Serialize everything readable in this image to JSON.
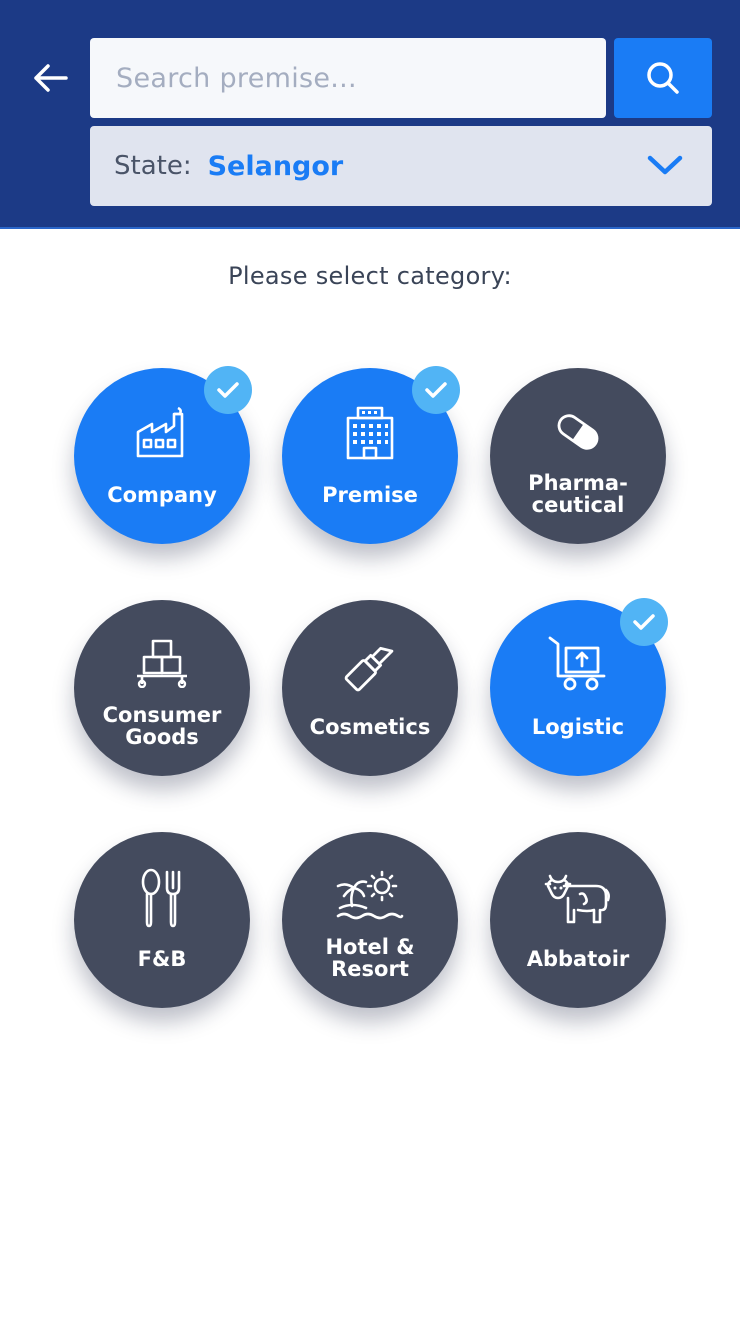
{
  "header": {
    "back_icon": "arrow-left-icon",
    "search": {
      "value": "",
      "placeholder": "Search premise..."
    },
    "search_icon": "search-icon",
    "state": {
      "label": "State:",
      "value": "Selangor",
      "icon": "chevron-down-icon"
    }
  },
  "prompt": "Please select category:",
  "categories": [
    {
      "label": "Company",
      "icon": "factory-icon",
      "selected": true
    },
    {
      "label": "Premise",
      "icon": "building-icon",
      "selected": true
    },
    {
      "label": "Pharma-\nceutical",
      "icon": "pill-icon",
      "selected": false
    },
    {
      "label": "Consumer\nGoods",
      "icon": "boxes-icon",
      "selected": false
    },
    {
      "label": "Cosmetics",
      "icon": "lipstick-icon",
      "selected": false
    },
    {
      "label": "Logistic",
      "icon": "hand-truck-icon",
      "selected": true
    },
    {
      "label": "F&B",
      "icon": "spoon-fork-icon",
      "selected": false
    },
    {
      "label": "Hotel &\nResort",
      "icon": "island-sun-icon",
      "selected": false
    },
    {
      "label": "Abbatoir",
      "icon": "cow-icon",
      "selected": false
    }
  ],
  "colors": {
    "header_bg": "#1c3a86",
    "accent": "#1a7cf5",
    "tile_default": "#444b5e",
    "check_badge": "#51b4f5"
  }
}
